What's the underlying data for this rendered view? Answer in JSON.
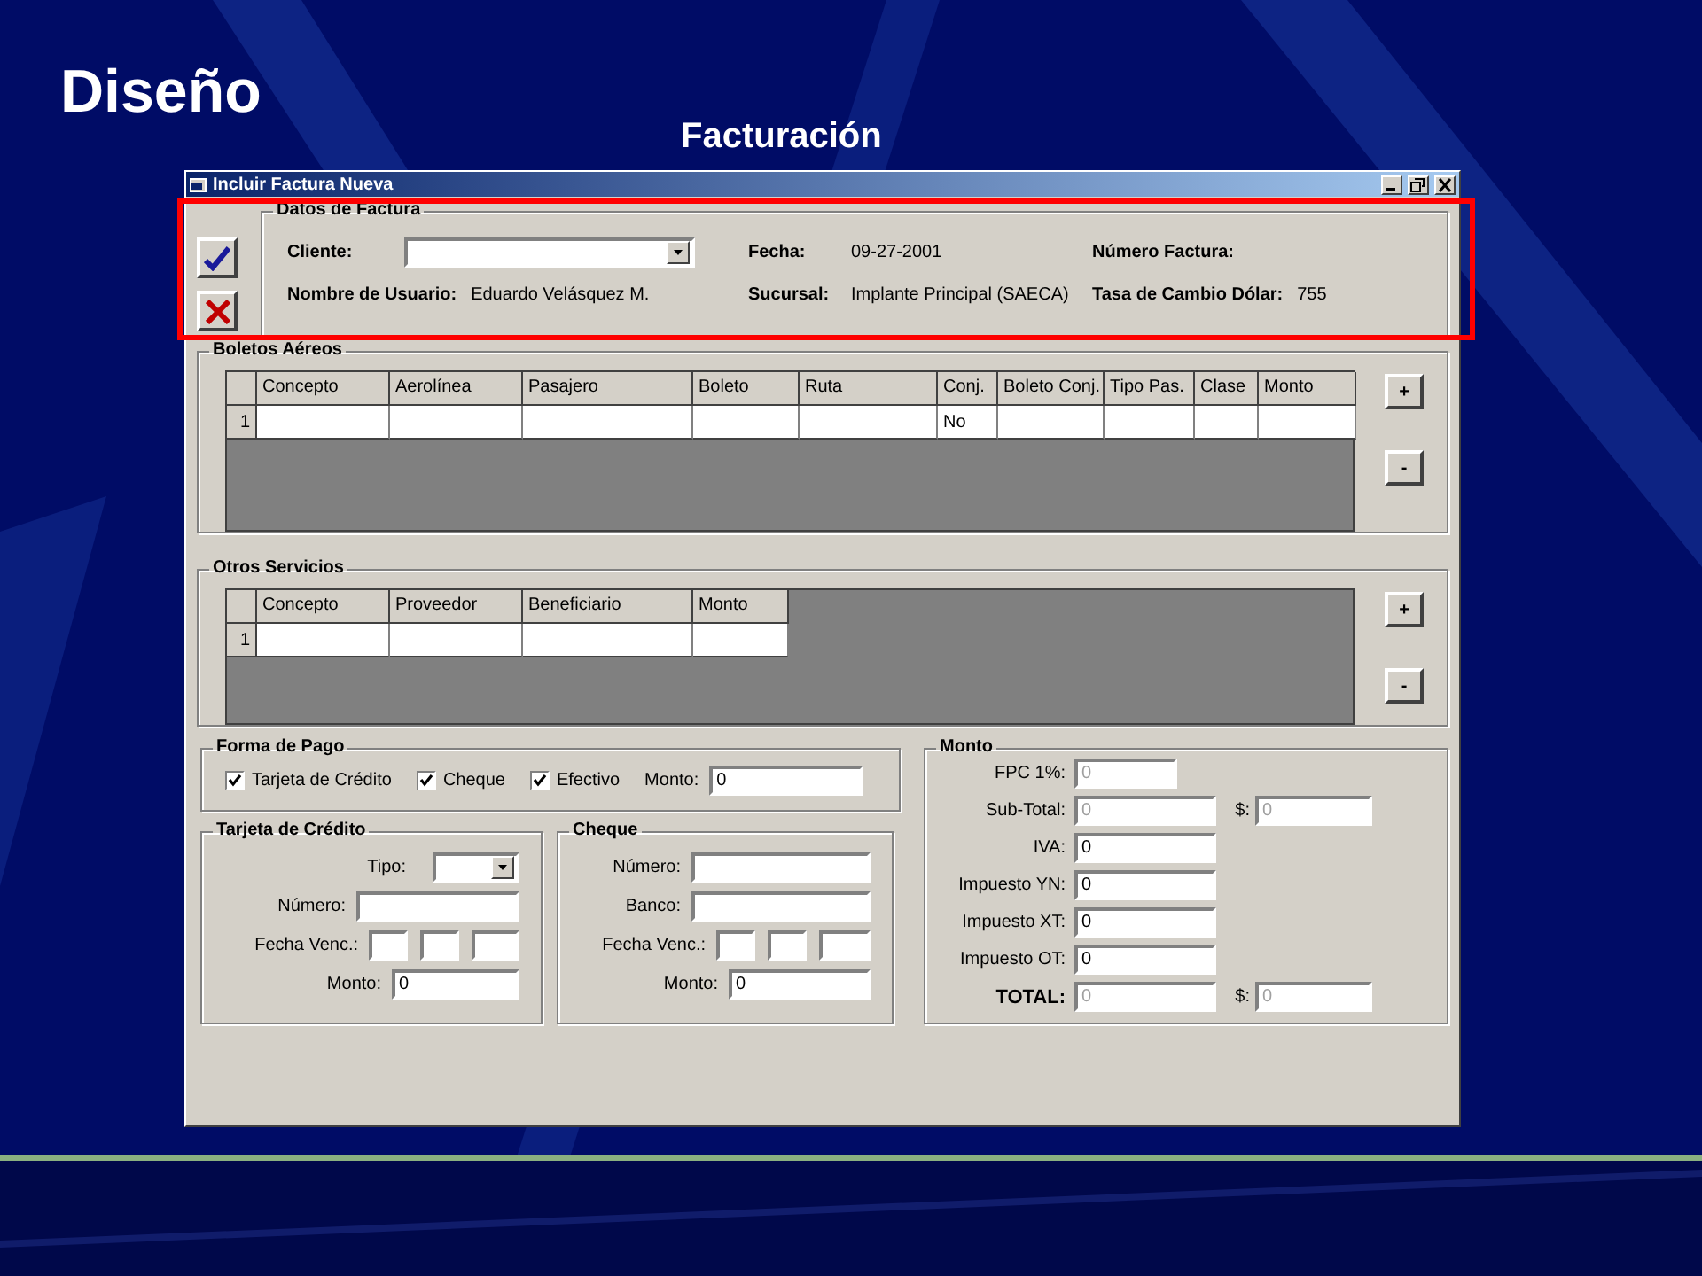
{
  "slide": {
    "title": "Diseño",
    "subtitle": "Facturación"
  },
  "window": {
    "title": "Incluir Factura Nueva"
  },
  "datos_factura": {
    "title": "Datos de Factura",
    "cliente_label": "Cliente:",
    "fecha_label": "Fecha:",
    "fecha": "09-27-2001",
    "numero_label": "Número Factura:",
    "usuario_label": "Nombre de Usuario:",
    "usuario": "Eduardo Velásquez M.",
    "sucursal_label": "Sucursal:",
    "sucursal": "Implante Principal (SAECA)",
    "tasa_label": "Tasa de Cambio Dólar:",
    "tasa": "755"
  },
  "boletos": {
    "title": "Boletos Aéreos",
    "add_label": "+",
    "remove_label": "-",
    "columns": [
      {
        "label": "Concepto"
      },
      {
        "label": "Aerolínea"
      },
      {
        "label": "Pasajero"
      },
      {
        "label": "Boleto"
      },
      {
        "label": "Ruta"
      },
      {
        "label": "Conj.",
        "kind": "choice"
      },
      {
        "label": "Boleto Conj."
      },
      {
        "label": "Tipo Pas."
      },
      {
        "label": "Clase"
      },
      {
        "label": "Monto"
      }
    ],
    "rows": [
      {
        "number": "1",
        "choice": "No"
      }
    ]
  },
  "otros": {
    "title": "Otros Servicios",
    "add_label": "+",
    "remove_label": "-",
    "columns": [
      {
        "label": "Concepto"
      },
      {
        "label": "Proveedor"
      },
      {
        "label": "Beneficiario"
      },
      {
        "label": "Monto"
      }
    ],
    "rows": [
      {
        "number": "1"
      }
    ]
  },
  "forma_pago": {
    "title": "Forma de Pago",
    "options": [
      {
        "label": "Tarjeta de Crédito",
        "checked": true
      },
      {
        "label": "Cheque",
        "checked": true
      },
      {
        "label": "Efectivo",
        "checked": true
      }
    ],
    "monto_label": "Monto:",
    "monto": "0"
  },
  "tarjeta": {
    "title": "Tarjeta de Crédito",
    "tipo_label": "Tipo:",
    "numero_label": "Número:",
    "fecha_label": "Fecha Venc.:",
    "monto_label": "Monto:",
    "monto": "0"
  },
  "cheque": {
    "title": "Cheque",
    "numero_label": "Número:",
    "banco_label": "Banco:",
    "fecha_label": "Fecha Venc.:",
    "monto_label": "Monto:",
    "monto": "0"
  },
  "monto": {
    "title": "Monto",
    "rows": [
      {
        "label": "FPC 1%:",
        "value": "0",
        "disabled": true,
        "kind": "short"
      },
      {
        "label": "Sub-Total:",
        "value": "0",
        "disabled": true,
        "usd_label": "$:",
        "usd": "0"
      },
      {
        "label": "IVA:",
        "value": "0",
        "disabled": false
      },
      {
        "label": "Impuesto YN:",
        "value": "0",
        "disabled": false
      },
      {
        "label": "Impuesto XT:",
        "value": "0",
        "disabled": false
      },
      {
        "label": "Impuesto OT:",
        "value": "0",
        "disabled": false
      },
      {
        "label": "TOTAL:",
        "value": "0",
        "disabled": true,
        "kind": "total",
        "usd_label": "$:",
        "usd": "0"
      }
    ]
  }
}
